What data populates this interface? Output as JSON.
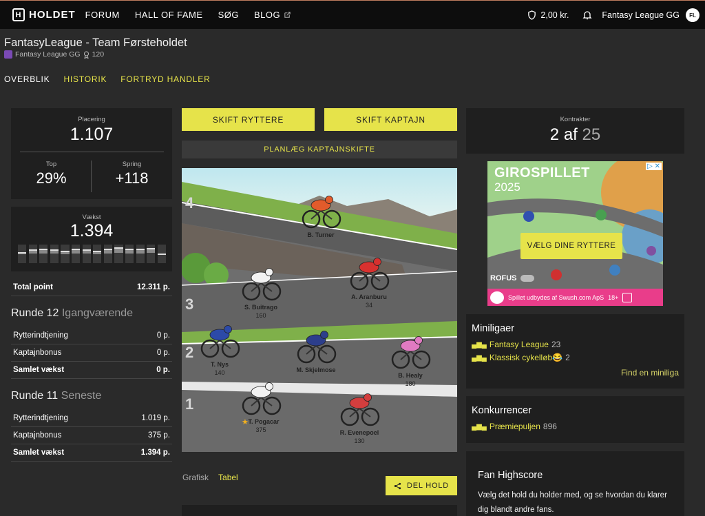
{
  "nav": {
    "logo": "HOLDET",
    "links": [
      "FORUM",
      "HALL OF FAME",
      "SØG",
      "BLOG"
    ],
    "balance": "2,00 kr.",
    "user": "Fantasy League GG",
    "avatar": "FL"
  },
  "header": {
    "title": "FantasyLeague - Team Førsteholdet",
    "league": "Fantasy League GG",
    "score": "120"
  },
  "tabs": [
    "OVERBLIK",
    "HISTORIK",
    "FORTRYD HANDLER"
  ],
  "stats": {
    "placering_label": "Placering",
    "placering": "1.107",
    "top_label": "Top",
    "top": "29%",
    "spring_label": "Spring",
    "spring": "+118",
    "vaekst_label": "Vækst",
    "vaekst": "1.394",
    "vaekst_bars": [
      0.35,
      0.55,
      0.6,
      0.55,
      0.45,
      0.6,
      0.55,
      0.45,
      0.6,
      0.75,
      0.65,
      0.6,
      0.7,
      0.2
    ],
    "total_label": "Total point",
    "total": "12.311 p."
  },
  "runde12": {
    "title": "Runde 12",
    "status": "Igangværende",
    "rows": [
      {
        "label": "Rytterindtjening",
        "value": "0 p."
      },
      {
        "label": "Kaptajnbonus",
        "value": "0 p."
      },
      {
        "label": "Samlet vækst",
        "value": "0 p."
      }
    ]
  },
  "runde11": {
    "title": "Runde 11",
    "status": "Seneste",
    "rows": [
      {
        "label": "Rytterindtjening",
        "value": "1.019 p."
      },
      {
        "label": "Kaptajnbonus",
        "value": "375 p."
      },
      {
        "label": "Samlet vækst",
        "value": "1.394 p."
      }
    ]
  },
  "buttons": {
    "skift_ryttere": "SKIFT RYTTERE",
    "skift_kaptajn": "SKIFT KAPTAJN",
    "planlaeg": "PLANLÆG KAPTAJNSKIFTE",
    "del_hold": "DEL HOLD"
  },
  "view_toggle": {
    "grafisk": "Grafisk",
    "tabel": "Tabel"
  },
  "rows_numbers": [
    "4",
    "3",
    "2",
    "1"
  ],
  "riders": [
    {
      "name": "B. Turner",
      "points": "",
      "jersey": "#e25b2b"
    },
    {
      "name": "S. Buitrago",
      "points": "160",
      "jersey": "#f2f2f2"
    },
    {
      "name": "A. Aranburu",
      "points": "34",
      "jersey": "#d8312f"
    },
    {
      "name": "T. Nys",
      "points": "140",
      "jersey": "#2c4aa8"
    },
    {
      "name": "M. Skjelmose",
      "points": "",
      "jersey": "#2c3e8c"
    },
    {
      "name": "B. Healy",
      "points": "180",
      "jersey": "#e07ac2"
    },
    {
      "name": "T. Pogacar",
      "points": "375",
      "jersey": "#f2f2f2",
      "captain": true
    },
    {
      "name": "R. Evenepoel",
      "points": "130",
      "jersey": "#d33e3e"
    }
  ],
  "contracts": {
    "label": "Kontrakter",
    "used": "2 af",
    "total": "25"
  },
  "ad": {
    "title": "GIROSPILLET",
    "year": "2025",
    "cta": "VÆLG DINE RYTTERE",
    "brand": "ROFUS",
    "footer": "Spillet udbydes af Swush.com ApS",
    "age": "18+"
  },
  "minileagues": {
    "title": "Miniligaer",
    "items": [
      {
        "name": "Fantasy League",
        "count": "23"
      },
      {
        "name": "Klassisk cykelløb😂",
        "count": "2"
      }
    ],
    "find": "Find en miniliga"
  },
  "competitions": {
    "title": "Konkurrencer",
    "items": [
      {
        "name": "Præmiepuljen",
        "count": "896"
      }
    ]
  },
  "fan": {
    "title": "Fan Highscore",
    "text": "Vælg det hold du holder med, og se hvordan du klarer dig blandt andre fans."
  },
  "colors": {
    "accent": "#e6e34a",
    "bg": "#2a2a2a",
    "card": "#1f1f1f"
  }
}
